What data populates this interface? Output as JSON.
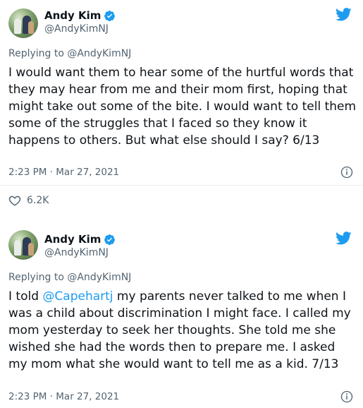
{
  "tweets": [
    {
      "author": {
        "display_name": "Andy Kim",
        "handle": "@AndyKimNJ",
        "verified": true
      },
      "replying_to": "Replying to @AndyKimNJ",
      "text": "I would want them to hear some of the hurtful words that they may hear from me and their mom first, hoping that might take out some of the bite. I would want to tell them some of the struggles that I faced so they know it happens to others. But what else should I say? 6/13",
      "timestamp": "2:23 PM · Mar 27, 2021",
      "likes": "6.2K"
    },
    {
      "author": {
        "display_name": "Andy Kim",
        "handle": "@AndyKimNJ",
        "verified": true
      },
      "replying_to": "Replying to @AndyKimNJ",
      "text_before_mention": "I told ",
      "mention": "@Capehartj",
      "text_after_mention": " my parents never talked to me when I was a child about discrimination I might face. I called my mom yesterday to seek her thoughts. She told me she wished she had the words then to prepare me. I asked my mom what she would want to tell me as a kid. 7/13",
      "timestamp": "2:23 PM · Mar 27, 2021"
    }
  ],
  "colors": {
    "twitter_blue": "#1d9bf0",
    "secondary_text": "#536471",
    "primary_text": "#0f1419"
  },
  "icons": [
    "twitter-bird-icon",
    "verified-badge-icon",
    "info-icon",
    "heart-icon"
  ]
}
